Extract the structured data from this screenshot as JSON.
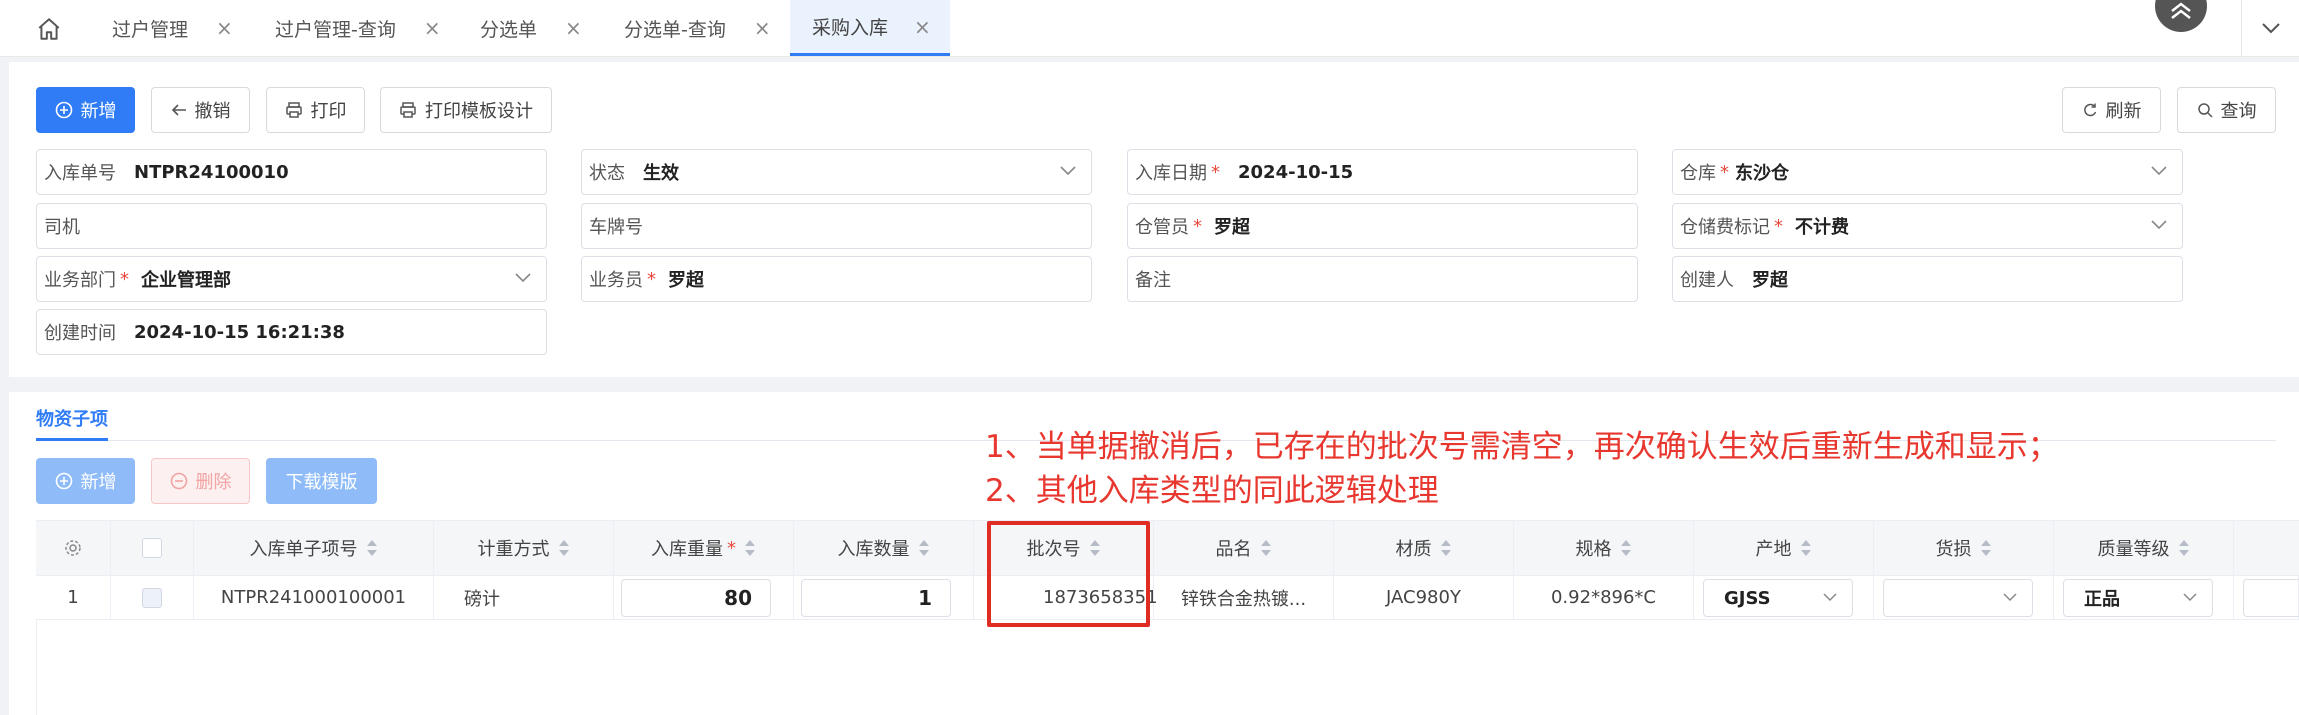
{
  "tabs": [
    {
      "label": "过户管理"
    },
    {
      "label": "过户管理-查询"
    },
    {
      "label": "分选单"
    },
    {
      "label": "分选单-查询"
    },
    {
      "label": "采购入库"
    }
  ],
  "toolbar": {
    "add": "新增",
    "revoke": "撤销",
    "print": "打印",
    "print_template": "打印模板设计",
    "refresh": "刷新",
    "query": "查询"
  },
  "form": {
    "order_no": {
      "label": "入库单号",
      "value": "NTPR24100010"
    },
    "status": {
      "label": "状态",
      "value": "生效"
    },
    "in_date": {
      "label": "入库日期",
      "value": "2024-10-15"
    },
    "warehouse": {
      "label": "仓库",
      "value": "东沙仓"
    },
    "driver": {
      "label": "司机",
      "value": ""
    },
    "plate": {
      "label": "车牌号",
      "value": ""
    },
    "keeper": {
      "label": "仓管员",
      "value": "罗超"
    },
    "storage_fee": {
      "label": "仓储费标记",
      "value": "不计费"
    },
    "dept": {
      "label": "业务部门",
      "value": "企业管理部"
    },
    "salesman": {
      "label": "业务员",
      "value": "罗超"
    },
    "remark": {
      "label": "备注",
      "value": ""
    },
    "creator": {
      "label": "创建人",
      "value": "罗超"
    },
    "created_at": {
      "label": "创建时间",
      "value": "2024-10-15 16:21:38"
    }
  },
  "subtab": {
    "label": "物资子项"
  },
  "sub_toolbar": {
    "add": "新增",
    "delete": "删除",
    "download": "下载模版"
  },
  "annotation": {
    "line1": "1、当单据撤消后，已存在的批次号需清空，再次确认生效后重新生成和显示；",
    "line2": "2、其他入库类型的同此逻辑处理"
  },
  "table": {
    "headers": [
      "入库单子项号",
      "计重方式",
      "入库重量",
      "入库数量",
      "批次号",
      "品名",
      "材质",
      "规格",
      "产地",
      "货损",
      "质量等级"
    ],
    "row": {
      "index": "1",
      "item_no": "NTPR241000100001",
      "weigh_mode": "磅计",
      "weight": "80",
      "qty": "1",
      "batch_no": "1873658351",
      "product": "锌铁合金热镀...",
      "material": "JAC980Y",
      "spec": "0.92*896*C",
      "origin": "GJSS",
      "damage": "",
      "grade": "正品"
    }
  }
}
